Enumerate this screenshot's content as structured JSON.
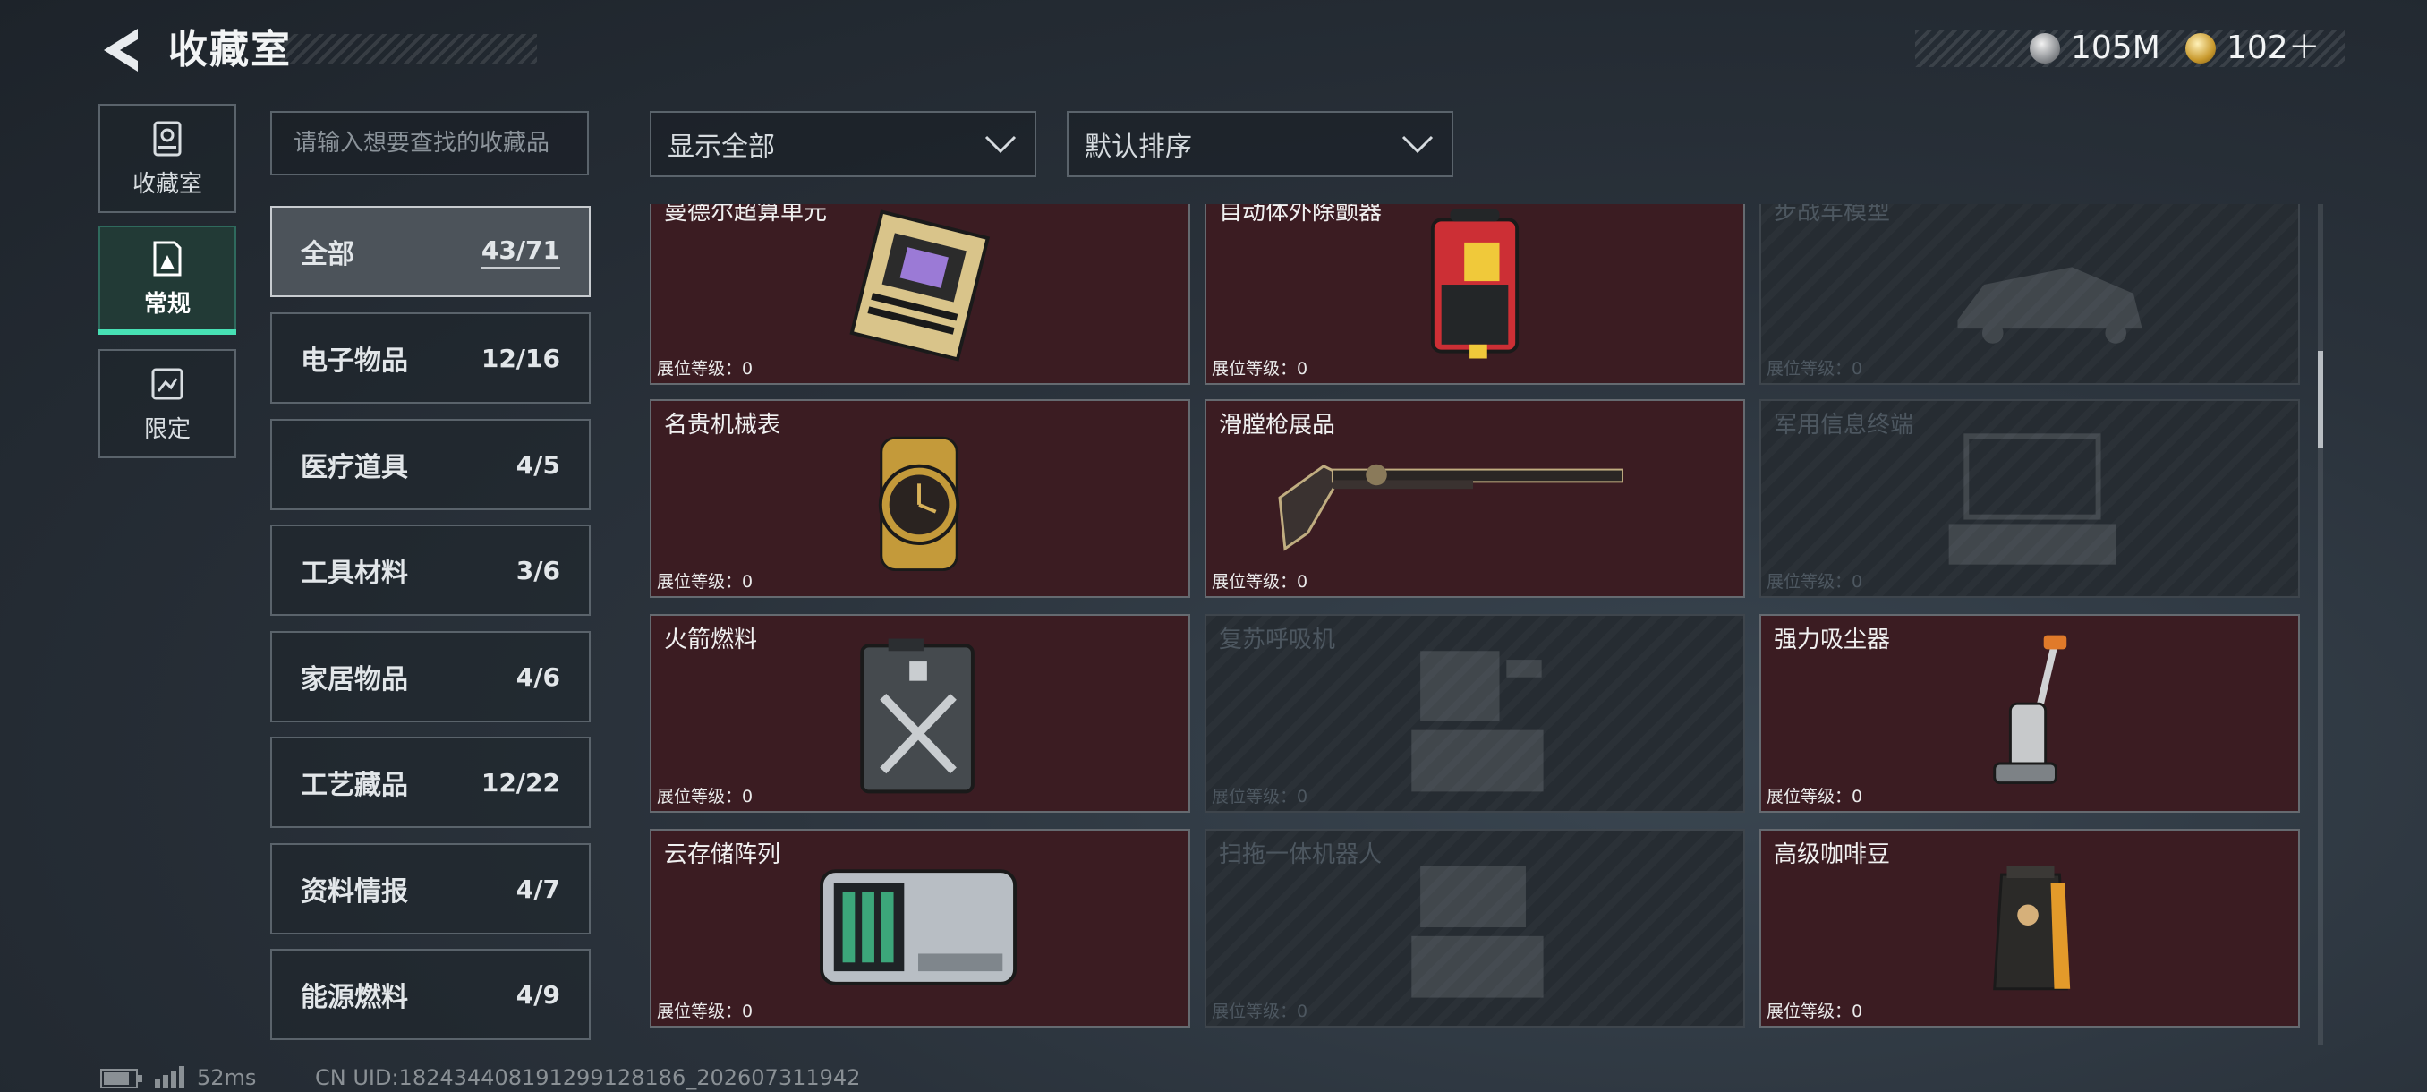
{
  "header": {
    "title": "收藏室",
    "currency": [
      {
        "icon": "silver-coin-icon",
        "value": "105M"
      },
      {
        "icon": "gold-coin-icon",
        "value": "102＋"
      }
    ]
  },
  "nav": [
    {
      "label": "收藏室",
      "icon": "collection-room-icon"
    },
    {
      "label": "常规",
      "icon": "regular-icon",
      "active": true
    },
    {
      "label": "限定",
      "icon": "limited-icon"
    }
  ],
  "search": {
    "placeholder": "请输入想要查找的收藏品"
  },
  "filters": {
    "show": "显示全部",
    "sort": "默认排序"
  },
  "categories": [
    {
      "name": "全部",
      "count": "43/71",
      "active": true
    },
    {
      "name": "电子物品",
      "count": "12/16"
    },
    {
      "name": "医疗道具",
      "count": "4/5"
    },
    {
      "name": "工具材料",
      "count": "3/6"
    },
    {
      "name": "家居物品",
      "count": "4/6"
    },
    {
      "name": "工艺藏品",
      "count": "12/22"
    },
    {
      "name": "资料情报",
      "count": "4/7"
    },
    {
      "name": "能源燃料",
      "count": "4/9"
    }
  ],
  "items": [
    {
      "name": "曼德尔超算单元",
      "level": "展位等级：0",
      "owned": true,
      "icon": "supercomputer-unit-icon"
    },
    {
      "name": "自动体外除颤器",
      "level": "展位等级：0",
      "owned": true,
      "icon": "defibrillator-icon"
    },
    {
      "name": "步战车模型",
      "level": "展位等级：0",
      "owned": false,
      "icon": "vehicle-model-icon"
    },
    {
      "name": "名贵机械表",
      "level": "展位等级：0",
      "owned": true,
      "icon": "mechanical-watch-icon"
    },
    {
      "name": "滑膛枪展品",
      "level": "展位等级：0",
      "owned": true,
      "icon": "musket-icon"
    },
    {
      "name": "军用信息终端",
      "level": "展位等级：0",
      "owned": false,
      "icon": "military-terminal-icon"
    },
    {
      "name": "火箭燃料",
      "level": "展位等级：0",
      "owned": true,
      "icon": "fuel-canister-icon"
    },
    {
      "name": "复苏呼吸机",
      "level": "展位等级：0",
      "owned": false,
      "icon": "ventilator-icon"
    },
    {
      "name": "强力吸尘器",
      "level": "展位等级：0",
      "owned": true,
      "icon": "vacuum-cleaner-icon"
    },
    {
      "name": "云存储阵列",
      "level": "展位等级：0",
      "owned": true,
      "icon": "storage-array-icon"
    },
    {
      "name": "扫拖一体机器人",
      "level": "展位等级：0",
      "owned": false,
      "icon": "mop-robot-icon"
    },
    {
      "name": "高级咖啡豆",
      "level": "展位等级：0",
      "owned": true,
      "icon": "coffee-beans-icon"
    }
  ],
  "footer": {
    "ping": "52ms",
    "uid": "CN UID:18243440819129912818​6_202607311942"
  }
}
